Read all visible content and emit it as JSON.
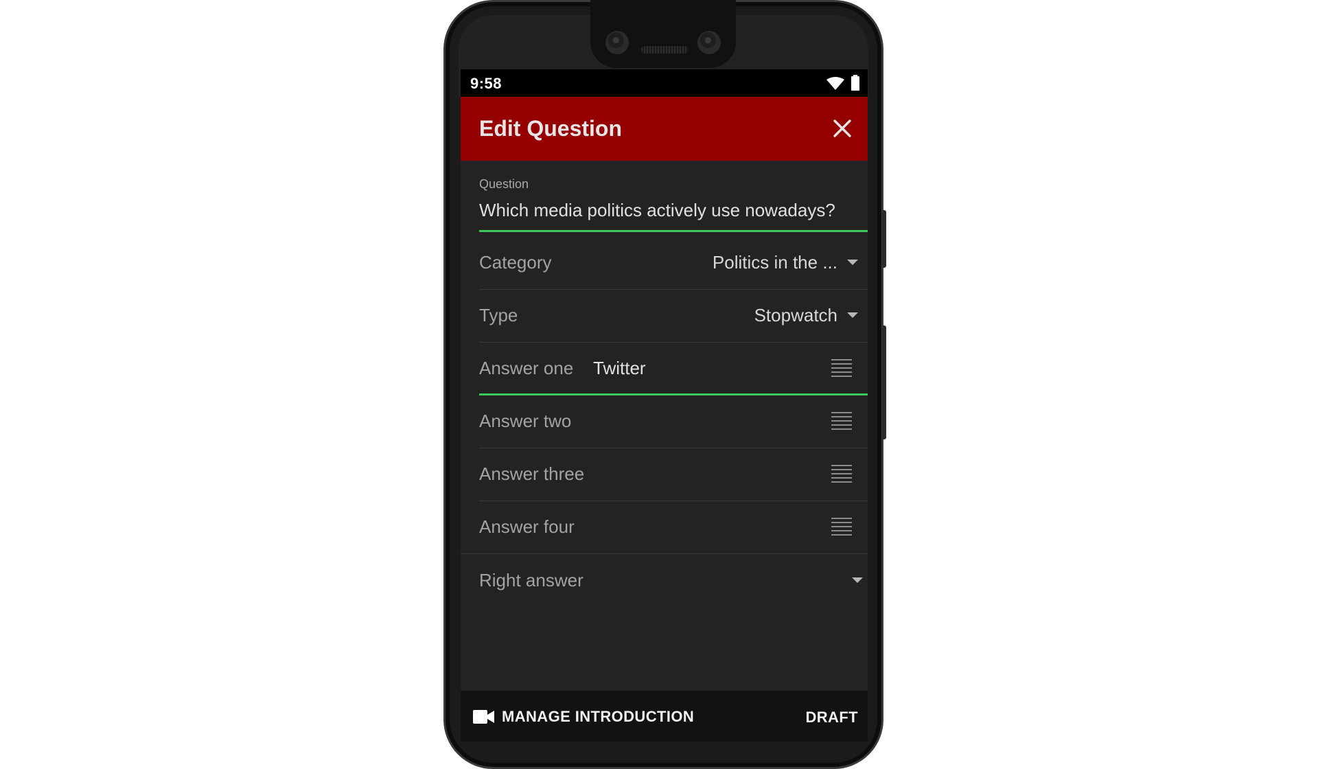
{
  "status_bar": {
    "time": "9:58",
    "wifi_icon": "wifi-icon",
    "battery_icon": "battery-icon"
  },
  "app_bar": {
    "title": "Edit Question",
    "close_icon": "close-icon",
    "background_color": "#950000"
  },
  "form": {
    "question": {
      "label": "Question",
      "value": "Which media politics actively use nowadays?"
    },
    "category": {
      "label": "Category",
      "selected": "Politics in the ..."
    },
    "type": {
      "label": "Type",
      "selected": "Stopwatch"
    },
    "answers": [
      {
        "label": "Answer one",
        "value": "Twitter"
      },
      {
        "label": "Answer two",
        "value": ""
      },
      {
        "label": "Answer three",
        "value": ""
      },
      {
        "label": "Answer four",
        "value": ""
      }
    ],
    "right_answer": {
      "label": "Right answer",
      "selected": ""
    },
    "accent_color": "#3dc95a"
  },
  "bottom_bar": {
    "manage_introduction_label": "MANAGE INTRODUCTION",
    "video_icon": "video-camera-icon",
    "draft_label": "DRAFT"
  }
}
